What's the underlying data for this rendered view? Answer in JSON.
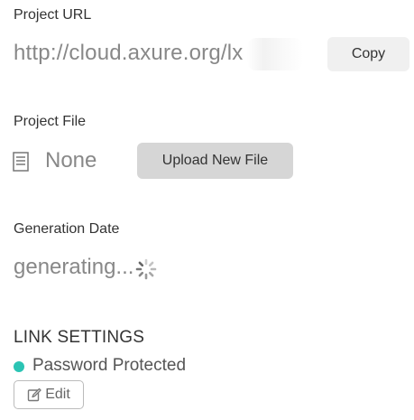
{
  "project_url": {
    "label": "Project URL",
    "value": "http://cloud.axure.org/lx",
    "copy_label": "Copy"
  },
  "project_file": {
    "label": "Project File",
    "value": "None",
    "upload_label": "Upload New File",
    "icon": "file-icon"
  },
  "generation_date": {
    "label": "Generation Date",
    "value": "generating...",
    "icon": "loading-spinner-icon"
  },
  "link_settings": {
    "title": "LINK SETTINGS",
    "status_text": "Password Protected",
    "status_color": "#2bc4b4",
    "edit_label": "Edit",
    "edit_icon": "edit-icon"
  },
  "colors": {
    "accent": "#2bc4b4",
    "muted_text": "#888888",
    "button_light": "#f0f0f0",
    "button_gray": "#d6d6d6"
  }
}
